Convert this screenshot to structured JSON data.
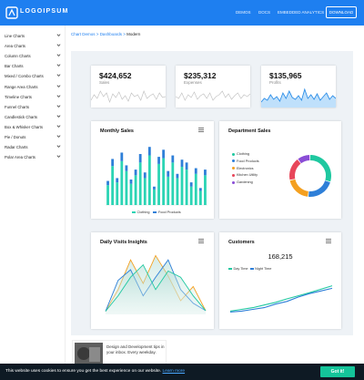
{
  "header": {
    "logo_text": "LOGOIPSUM",
    "nav": [
      "DEMOS",
      "DOCS",
      "EMBEDDED ANALYTICS"
    ],
    "download_label": "DOWNLOAD",
    "brand_color": "#1e7ff0"
  },
  "sidebar": {
    "items": [
      {
        "label": "Line Charts"
      },
      {
        "label": "Area Charts"
      },
      {
        "label": "Column Charts"
      },
      {
        "label": "Bar Charts"
      },
      {
        "label": "Mixed / Combo Charts"
      },
      {
        "label": "Range Area Charts"
      },
      {
        "label": "Timeline Charts"
      },
      {
        "label": "Funnel Charts"
      },
      {
        "label": "Candlestick Charts"
      },
      {
        "label": "Box & Whisker Charts"
      },
      {
        "label": "Pie / Donuts"
      },
      {
        "label": "Radar Charts"
      },
      {
        "label": "Polar Area Charts"
      }
    ],
    "chevron_icon": "chevron-down-icon"
  },
  "breadcrumb": {
    "items": [
      "Chart Demos",
      "Dashboards"
    ],
    "separator": ">",
    "current": "Modern"
  },
  "stats": [
    {
      "value": "$424,652",
      "label": "Sales",
      "fill": false
    },
    {
      "value": "$235,312",
      "label": "Expenses",
      "fill": false
    },
    {
      "value": "$135,965",
      "label": "Profits",
      "fill": true
    }
  ],
  "monthly_sales": {
    "title": "Monthly Sales",
    "menu_icon": "hamburger-menu-icon",
    "chart_data": {
      "type": "bar",
      "stacked": true,
      "categories": [
        "1",
        "2",
        "3",
        "4",
        "5",
        "6",
        "7",
        "8",
        "9",
        "10",
        "11",
        "12",
        "13",
        "14",
        "15",
        "16",
        "17",
        "18",
        "19",
        "20",
        "21",
        "22"
      ],
      "series": [
        {
          "name": "Clothing",
          "color": "#2bd4b4",
          "values": [
            28,
            55,
            32,
            62,
            48,
            30,
            42,
            60,
            38,
            70,
            22,
            58,
            66,
            40,
            60,
            38,
            54,
            50,
            26,
            44,
            20,
            42
          ]
        },
        {
          "name": "Food Products",
          "color": "#2e7fd8",
          "values": [
            6,
            10,
            6,
            12,
            8,
            6,
            8,
            12,
            8,
            12,
            4,
            10,
            12,
            8,
            10,
            6,
            10,
            10,
            6,
            8,
            4,
            8
          ]
        }
      ],
      "ylim": [
        0,
        90
      ]
    }
  },
  "department_sales": {
    "title": "Department Sales",
    "chart_data": {
      "type": "pie",
      "donut": true,
      "categories": [
        "Clothing",
        "Food Products",
        "Electronics",
        "Kitchen Utility",
        "Gardening"
      ],
      "values": [
        30,
        22,
        20,
        18,
        10
      ],
      "colors": [
        "#1fc8a0",
        "#2e7fd8",
        "#f4a020",
        "#e8465a",
        "#8a4dd6"
      ]
    }
  },
  "daily_visits": {
    "title": "Daily Visits Insights",
    "menu_icon": "hamburger-menu-icon",
    "chart_data": {
      "type": "area",
      "x": [
        0,
        1,
        2,
        3,
        4,
        5,
        6,
        7,
        8
      ],
      "series": [
        {
          "color": "#f4a020",
          "values": [
            5,
            40,
            88,
            50,
            95,
            62,
            22,
            45,
            6
          ]
        },
        {
          "color": "#2e7fd8",
          "values": [
            5,
            55,
            72,
            30,
            60,
            88,
            40,
            18,
            6
          ]
        },
        {
          "color": "#1fc8a0",
          "values": [
            5,
            30,
            60,
            80,
            40,
            70,
            60,
            30,
            6
          ]
        }
      ],
      "ylim": [
        0,
        100
      ]
    }
  },
  "customers": {
    "title": "Customers",
    "value": "168,215",
    "menu_icon": "hamburger-menu-icon",
    "chart_data": {
      "type": "line",
      "x": [
        0,
        1,
        2,
        3,
        4,
        5,
        6,
        7,
        8,
        9
      ],
      "series": [
        {
          "name": "Day Time",
          "color": "#1fc8a0",
          "values": [
            20,
            24,
            28,
            34,
            40,
            48,
            55,
            62,
            70,
            78
          ]
        },
        {
          "name": "Night Time",
          "color": "#2e7fd8",
          "values": [
            18,
            20,
            24,
            28,
            36,
            42,
            52,
            60,
            66,
            72
          ]
        }
      ],
      "ylim": [
        0,
        100
      ]
    }
  },
  "promo": {
    "text": "Design and Development tips in your inbox. Every weekday."
  },
  "cookie": {
    "text": "This website uses cookies to ensure you get the best experience on our website.",
    "link": "Learn more",
    "button": "Got it!",
    "button_color": "#14c49a"
  }
}
